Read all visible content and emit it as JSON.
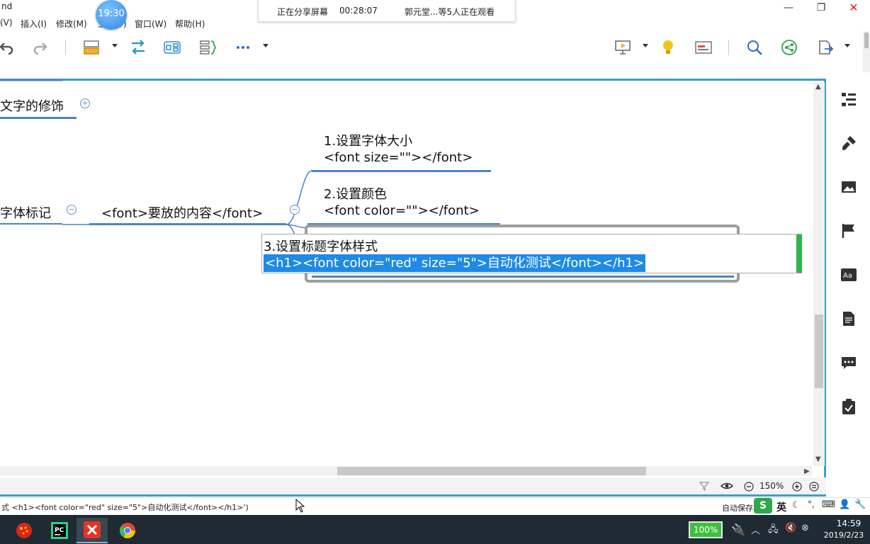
{
  "window": {
    "title_fragment": "nd",
    "controls": {
      "minimize": "—",
      "maximize": "❐",
      "close": "✕"
    }
  },
  "menu": {
    "items": [
      "(V)",
      "插入(I)",
      "修改(M)",
      "工具(T)",
      "窗口(W)",
      "帮助(H)"
    ]
  },
  "share_banner": {
    "status": "正在分享屏幕",
    "elapsed": "00:28:07",
    "viewers": "郭元堂...等5人正在观看"
  },
  "clock_bubble": "19:30",
  "toolbar": {
    "icons": [
      "undo-icon",
      "redo-icon",
      "topic-icon",
      "relationship-icon",
      "boundary-icon",
      "summary-icon",
      "more-icon",
      "presentation-icon",
      "idea-icon",
      "gantt-icon",
      "search-icon",
      "share-icon",
      "export-icon"
    ]
  },
  "mindmap": {
    "partial_parent": "文字的修饰",
    "partial_node": "字体标记",
    "central": "<font>要放的内容</font>",
    "child1": {
      "title": "1.设置字体大小",
      "code": "<font size=\"\"></font>"
    },
    "child2": {
      "title": "2.设置颜色",
      "code": "<font color=\"\"></font>"
    },
    "editing": {
      "title": "3.设置标题字体样式",
      "code": "<h1><font color=\"red\" size=\"5\">自动化测试</font></h1>"
    },
    "collapse_minus": "−",
    "expand_plus": "+"
  },
  "zoom": {
    "level": "150%"
  },
  "status": {
    "text": "式 <h1><font color=\"red\" size=\"5\">自动化测试</font></h1>')",
    "autosave": "自动保存"
  },
  "ime": {
    "label": "英"
  },
  "taskbar": {
    "battery": "100%",
    "time": "14:59",
    "date": "2019/2/23"
  },
  "colors": {
    "accent": "#3aa0cf",
    "topic_line": "#4a86c8",
    "selection": "#1e8ae6",
    "taskbar": "#1f2a33"
  }
}
